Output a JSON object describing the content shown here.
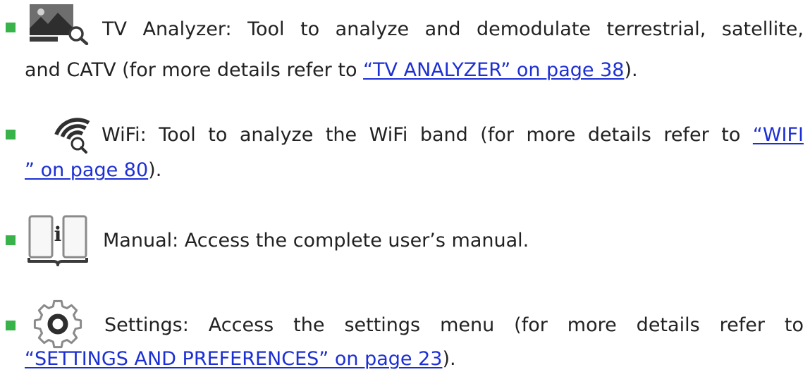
{
  "colors": {
    "bullet": "#38b34a",
    "text": "#222222",
    "link": "#1c2fd4"
  },
  "items": [
    {
      "icon": "tv-analyzer-icon",
      "line1": "TV Analyzer: Tool to analyze and demodulate terrestrial, satellite,",
      "line2": "and CATV (for more details refer to ",
      "link": "“TV ANALYZER” on page 38",
      "end": ")."
    },
    {
      "icon": "wifi-analyzer-icon",
      "line1": "WiFi: Tool to analyze the WiFi band (for more details refer to ",
      "link_start": "“WIFI",
      "link_end": "” on page 80",
      "end": ")."
    },
    {
      "icon": "manual-book-icon",
      "icon_glyph": "i",
      "line1": "Manual: Access the complete user’s manual."
    },
    {
      "icon": "settings-gear-icon",
      "line1": "Settings: Access the settings menu (for more details refer to",
      "link": "“SETTINGS AND PREFERENCES” on page 23",
      "end": ")."
    }
  ]
}
